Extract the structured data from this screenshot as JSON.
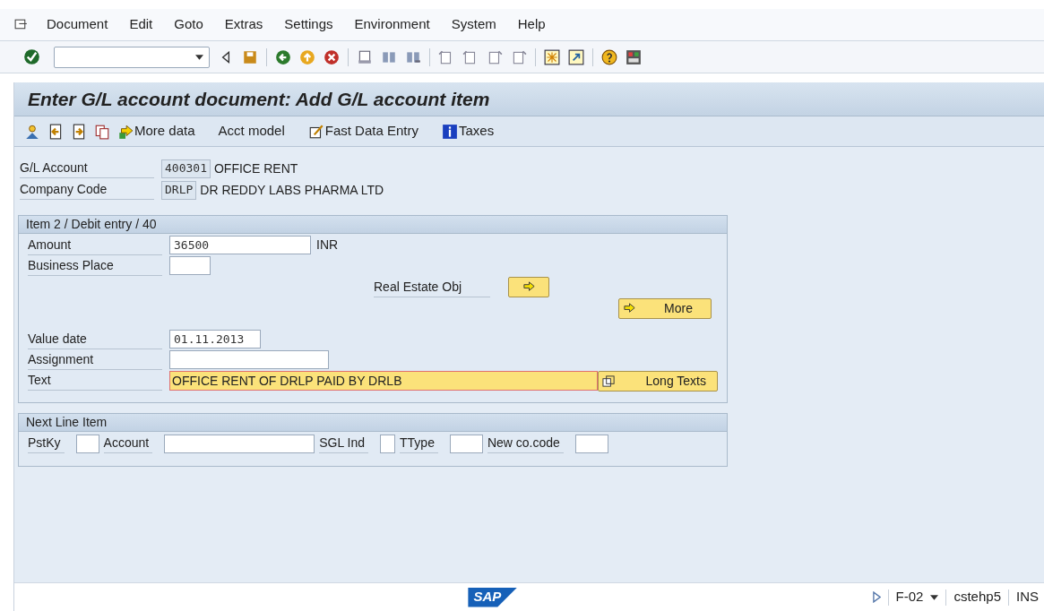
{
  "menu": [
    "Document",
    "Edit",
    "Goto",
    "Extras",
    "Settings",
    "Environment",
    "System",
    "Help"
  ],
  "title": "Enter G/L account document: Add G/L account item",
  "app_toolbar": [
    {
      "kind": "icon"
    },
    {
      "kind": "icon"
    },
    {
      "kind": "icon"
    },
    {
      "kind": "icon"
    },
    {
      "kind": "button",
      "label": "More data"
    },
    {
      "kind": "button",
      "label": "Acct model"
    },
    {
      "kind": "button",
      "label": "Fast Data Entry"
    },
    {
      "kind": "button",
      "label": "Taxes"
    }
  ],
  "header": [
    {
      "label": "G/L Account",
      "value": "400301",
      "description": "OFFICE RENT"
    },
    {
      "label": "Company Code",
      "value": "DRLP",
      "description": "DR REDDY LABS PHARMA LTD"
    }
  ],
  "item_section": {
    "title": "Item 2 / Debit entry / 40",
    "rows": [
      {
        "kind": "field",
        "label": "Amount",
        "value": "36500",
        "unit": "INR"
      },
      {
        "kind": "field",
        "label": "Business Place"
      },
      {
        "kind": "object",
        "label": "Real Estate Obj"
      },
      {
        "kind": "more",
        "button": "More"
      },
      {
        "kind": "field",
        "label": "Value date",
        "value": "01.11.2013"
      },
      {
        "kind": "field",
        "label": "Assignment"
      },
      {
        "kind": "text",
        "label": "Text",
        "value": "OFFICE RENT OF DRLP PAID BY DRLB",
        "focused": true,
        "button": "Long Texts"
      }
    ]
  },
  "next_line_item": {
    "title": "Next Line Item",
    "fields": [
      {
        "label": "PstKy"
      },
      {
        "label": "Account"
      },
      {
        "label": "SGL Ind"
      },
      {
        "label": "TType"
      },
      {
        "label": "New co.code"
      }
    ]
  },
  "status_bar": {
    "logo": "SAP",
    "transaction": "F-02",
    "server": "cstehp5",
    "mode": "INS"
  }
}
